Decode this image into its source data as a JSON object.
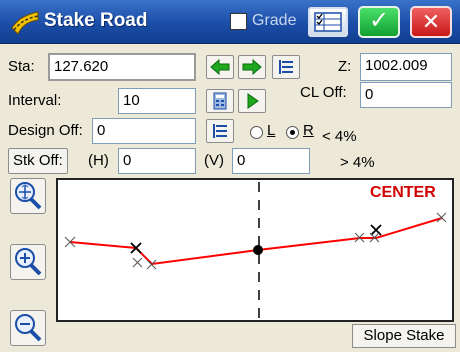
{
  "window": {
    "title": "Stake Road",
    "grade_label": "Grade",
    "grade_checked": false,
    "ok_icon": "checkmark-icon",
    "close_icon": "close-icon",
    "ok_glyph": "✓",
    "close_glyph": "✕"
  },
  "station": {
    "label": "Sta:",
    "value": "127.620",
    "z_label": "Z:",
    "z_value": "1002.009"
  },
  "interval": {
    "label": "Interval:",
    "value": "10",
    "cl_off_label": "CL Off:",
    "cl_off_value": "0"
  },
  "design_off": {
    "label": "Design Off:",
    "value": "0",
    "side_options": [
      "L",
      "R"
    ],
    "side_selected": "R",
    "grade_lt": "< 4%",
    "grade_gt": "> 4%"
  },
  "stake_off": {
    "button_label": "Stk Off:",
    "h_label": "(H)",
    "h_value": "0",
    "v_label": "(V)",
    "v_value": "0"
  },
  "plot": {
    "center_label": "CENTER",
    "slope_stake_label": "Slope Stake",
    "line_color": "#ff0000"
  },
  "toolbar": {
    "icons": [
      "arrow-left-icon",
      "arrow-right-icon",
      "list-icon",
      "calculator-icon",
      "play-icon",
      "list-icon",
      "zoom-extents-icon",
      "zoom-in-icon",
      "zoom-out-icon"
    ]
  },
  "colors": {
    "titlebar": "#1b4ea8",
    "ok": "#10a030",
    "close": "#c81818",
    "arrow_green": "#1fa81f"
  }
}
